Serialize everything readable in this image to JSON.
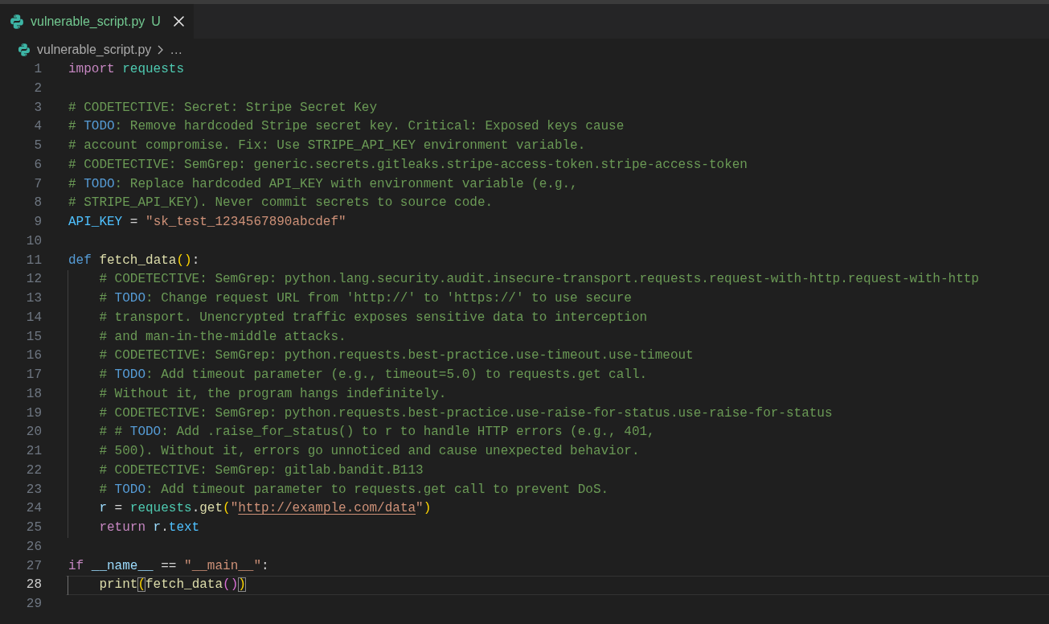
{
  "tabs": [
    {
      "label": "vulnerable_script.py",
      "status": "U",
      "selected": true
    }
  ],
  "breadcrumb": [
    "vulnerable_script.py",
    "…"
  ],
  "editor": {
    "lines": [
      {
        "number": "1",
        "current": false,
        "tokens": [
          {
            "kind": "control",
            "text": "import"
          },
          {
            "kind": "module",
            "text": " requests"
          }
        ]
      },
      {
        "number": "2",
        "current": false
      },
      {
        "number": "3",
        "current": false,
        "tokens": [
          {
            "kind": "comment",
            "text": "# CODETECTIVE: Secret: Stripe Secret Key"
          }
        ]
      },
      {
        "number": "4",
        "current": false,
        "tokens": [
          {
            "kind": "comment",
            "text": "# "
          },
          {
            "kind": "todo",
            "text": "TODO"
          },
          {
            "kind": "comment",
            "text": ": Remove hardcoded Stripe secret key. Critical: Exposed keys cause"
          }
        ]
      },
      {
        "number": "5",
        "current": false,
        "tokens": [
          {
            "kind": "comment",
            "text": "# account compromise. Fix: Use STRIPE_API_KEY environment variable."
          }
        ]
      },
      {
        "number": "6",
        "current": false,
        "tokens": [
          {
            "kind": "comment",
            "text": "# CODETECTIVE: SemGrep: generic.secrets.gitleaks.stripe-access-token.stripe-access-token"
          }
        ]
      },
      {
        "number": "7",
        "current": false,
        "tokens": [
          {
            "kind": "comment",
            "text": "# "
          },
          {
            "kind": "todo",
            "text": "TODO"
          },
          {
            "kind": "comment",
            "text": ": Replace hardcoded API_KEY with environment variable (e.g.,"
          }
        ]
      },
      {
        "number": "8",
        "current": false,
        "tokens": [
          {
            "kind": "comment",
            "text": "# STRIPE_API_KEY). Never commit secrets to source code."
          }
        ]
      },
      {
        "number": "9",
        "current": false,
        "tokens": [
          {
            "kind": "constant",
            "text": "API_KEY"
          },
          {
            "kind": "plain",
            "text": " = "
          },
          {
            "kind": "string",
            "text": "\"sk_test_1234567890abcdef\""
          }
        ]
      },
      {
        "number": "10",
        "current": false
      },
      {
        "number": "11",
        "current": false,
        "tokens": [
          {
            "kind": "keyword",
            "text": "def"
          },
          {
            "kind": "function",
            "text": " fetch_data"
          },
          {
            "kind": "bracket",
            "text": "("
          },
          {
            "kind": "bracket",
            "text": ")"
          },
          {
            "kind": "plain",
            "text": ":"
          }
        ],
        "children": [
          {
            "number": "12",
            "current": false,
            "tokens": [
              {
                "kind": "comment",
                "text": "# CODETECTIVE: SemGrep: python.lang.security.audit.insecure-transport.requests.request-with-http.request-with-http"
              }
            ]
          },
          {
            "number": "13",
            "current": false,
            "tokens": [
              {
                "kind": "comment",
                "text": "# "
              },
              {
                "kind": "todo",
                "text": "TODO"
              },
              {
                "kind": "comment",
                "text": ": Change request URL from 'http://' to 'https://' to use secure"
              }
            ]
          },
          {
            "number": "14",
            "current": false,
            "tokens": [
              {
                "kind": "comment",
                "text": "# transport. Unencrypted traffic exposes sensitive data to interception"
              }
            ]
          },
          {
            "number": "15",
            "current": false,
            "tokens": [
              {
                "kind": "comment",
                "text": "# and man-in-the-middle attacks."
              }
            ]
          },
          {
            "number": "16",
            "current": false,
            "tokens": [
              {
                "kind": "comment",
                "text": "# CODETECTIVE: SemGrep: python.requests.best-practice.use-timeout.use-timeout"
              }
            ]
          },
          {
            "number": "17",
            "current": false,
            "tokens": [
              {
                "kind": "comment",
                "text": "# "
              },
              {
                "kind": "todo",
                "text": "TODO"
              },
              {
                "kind": "comment",
                "text": ": Add timeout parameter (e.g., timeout=5.0) to requests.get call."
              }
            ]
          },
          {
            "number": "18",
            "current": false,
            "tokens": [
              {
                "kind": "comment",
                "text": "# Without it, the program hangs indefinitely."
              }
            ]
          },
          {
            "number": "19",
            "current": false,
            "tokens": [
              {
                "kind": "comment",
                "text": "# CODETECTIVE: SemGrep: python.requests.best-practice.use-raise-for-status.use-raise-for-status"
              }
            ]
          },
          {
            "number": "20",
            "current": false,
            "tokens": [
              {
                "kind": "comment",
                "text": "# # "
              },
              {
                "kind": "todo",
                "text": "TODO"
              },
              {
                "kind": "comment",
                "text": ": Add .raise_for_status() to r to handle HTTP errors (e.g., 401,"
              }
            ]
          },
          {
            "number": "21",
            "current": false,
            "tokens": [
              {
                "kind": "comment",
                "text": "# 500). Without it, errors go unnoticed and cause unexpected behavior."
              }
            ]
          },
          {
            "number": "22",
            "current": false,
            "tokens": [
              {
                "kind": "comment",
                "text": "# CODETECTIVE: SemGrep: gitlab.bandit.B113"
              }
            ]
          },
          {
            "number": "23",
            "current": false,
            "tokens": [
              {
                "kind": "comment",
                "text": "# "
              },
              {
                "kind": "todo",
                "text": "TODO"
              },
              {
                "kind": "comment",
                "text": ": Add timeout parameter to requests.get call to prevent DoS."
              }
            ]
          },
          {
            "number": "24",
            "current": false,
            "tokens": [
              {
                "kind": "variable",
                "text": "r"
              },
              {
                "kind": "plain",
                "text": " = "
              },
              {
                "kind": "module",
                "text": "requests"
              },
              {
                "kind": "plain",
                "text": "."
              },
              {
                "kind": "function",
                "text": "get"
              },
              {
                "kind": "bracket",
                "text": "("
              },
              {
                "kind": "string",
                "text": "\""
              },
              {
                "kind": "url",
                "text": "http://example.com/data"
              },
              {
                "kind": "string",
                "text": "\""
              },
              {
                "kind": "bracket",
                "text": ")"
              }
            ]
          },
          {
            "number": "25",
            "current": false,
            "tokens": [
              {
                "kind": "control",
                "text": "return"
              },
              {
                "kind": "variable",
                "text": " r"
              },
              {
                "kind": "plain",
                "text": "."
              },
              {
                "kind": "constant",
                "text": "text"
              }
            ]
          }
        ]
      },
      {
        "number": "26",
        "current": false
      },
      {
        "number": "27",
        "current": false,
        "tokens": [
          {
            "kind": "control",
            "text": "if"
          },
          {
            "kind": "variable",
            "text": " __name__"
          },
          {
            "kind": "plain",
            "text": " == "
          },
          {
            "kind": "string",
            "text": "\"__main__\""
          },
          {
            "kind": "plain",
            "text": ":"
          }
        ],
        "children": [
          {
            "number": "28",
            "current": true,
            "tokens": [
              {
                "kind": "function",
                "text": "print"
              },
              {
                "kind": "matched",
                "text": "("
              },
              {
                "kind": "function",
                "text": "fetch_data"
              },
              {
                "kind": "bracket2",
                "text": "("
              },
              {
                "kind": "bracket2",
                "text": ")"
              },
              {
                "kind": "matched",
                "text": ")"
              }
            ]
          }
        ]
      },
      {
        "number": "29",
        "current": false
      }
    ]
  }
}
